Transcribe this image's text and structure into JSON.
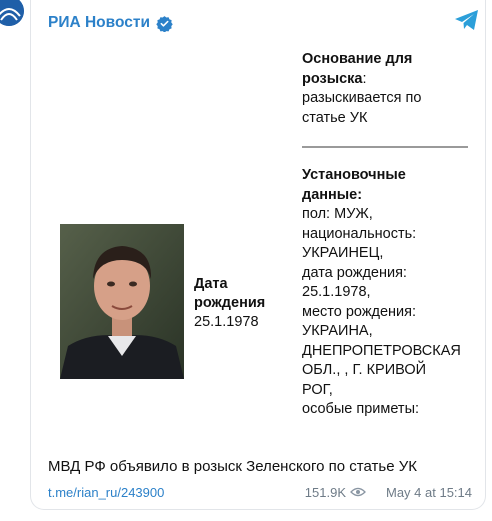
{
  "channel": {
    "name": "РИА Новости",
    "accent_color": "#2c81c9"
  },
  "icons": [
    "ria-logo-icon",
    "verified-badge-icon",
    "telegram-icon",
    "views-eye-icon"
  ],
  "document": {
    "dob_label_line1": "Дата",
    "dob_label_line2": "рождения",
    "dob_value": "25.1.1978",
    "basis_line1": "Основание для",
    "basis_line2": "розыска",
    "basis_colon": ":",
    "basis_text_line1": "разыскивается по",
    "basis_text_line2": "статье УК",
    "ident_line1": "Установочные",
    "ident_line2": "данные:",
    "lines": [
      "пол: МУЖ,",
      "национальность:",
      "УКРАИНЕЦ,",
      "дата рождения:",
      "25.1.1978,",
      "место рождения:",
      "УКРАИНА,",
      "ДНЕПРОПЕТРОВСКАЯ",
      "ОБЛ., , Г. КРИВОЙ",
      "РОГ,",
      "особые приметы:"
    ]
  },
  "post": {
    "caption": "МВД РФ объявило в розыск Зеленского по статье УК",
    "link": "t.me/rian_ru/243900",
    "views": "151.9K",
    "date": "May 4 at 15:14"
  }
}
